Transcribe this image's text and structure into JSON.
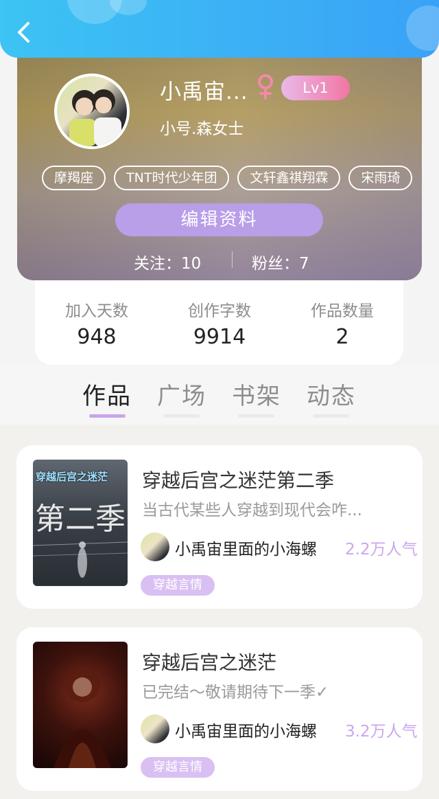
{
  "header": {
    "back_icon": "chevron-left-icon"
  },
  "profile": {
    "username": "小禹宙...",
    "gender_icon": "female-icon",
    "level": "Lv1",
    "subname": "小号.森女士",
    "tags": [
      "摩羯座",
      "TNT时代少年团",
      "文轩鑫祺翔霖",
      "宋雨琦"
    ],
    "edit_label": "编辑资料",
    "following_text": "关注：10",
    "fans_text": "粉丝：7"
  },
  "stats": [
    {
      "label": "加入天数",
      "value": "948"
    },
    {
      "label": "创作字数",
      "value": "9914"
    },
    {
      "label": "作品数量",
      "value": "2"
    }
  ],
  "tabs": [
    {
      "label": "作品",
      "active": true
    },
    {
      "label": "广场",
      "active": false
    },
    {
      "label": "书架",
      "active": false
    },
    {
      "label": "动态",
      "active": false
    }
  ],
  "works": [
    {
      "cover_text": "穿越后宫之迷茫",
      "cover_big": "第二季",
      "title": "穿越后宫之迷茫第二季",
      "desc": "当古代某些人穿越到现代会咋...",
      "author": "小禹宙里面的小海螺",
      "popularity": "2.2万人气",
      "genre": "穿越言情"
    },
    {
      "title": "穿越后宫之迷茫",
      "desc": "已完结～敬请期待下一季✓",
      "author": "小禹宙里面的小海螺",
      "popularity": "3.2万人气",
      "genre": "穿越言情"
    }
  ],
  "colors": {
    "accent": "#b99ee8",
    "header_start": "#3dc3f4",
    "header_end": "#3aa2f6",
    "level_end": "#f276a2",
    "popularity": "#caa7ef"
  }
}
